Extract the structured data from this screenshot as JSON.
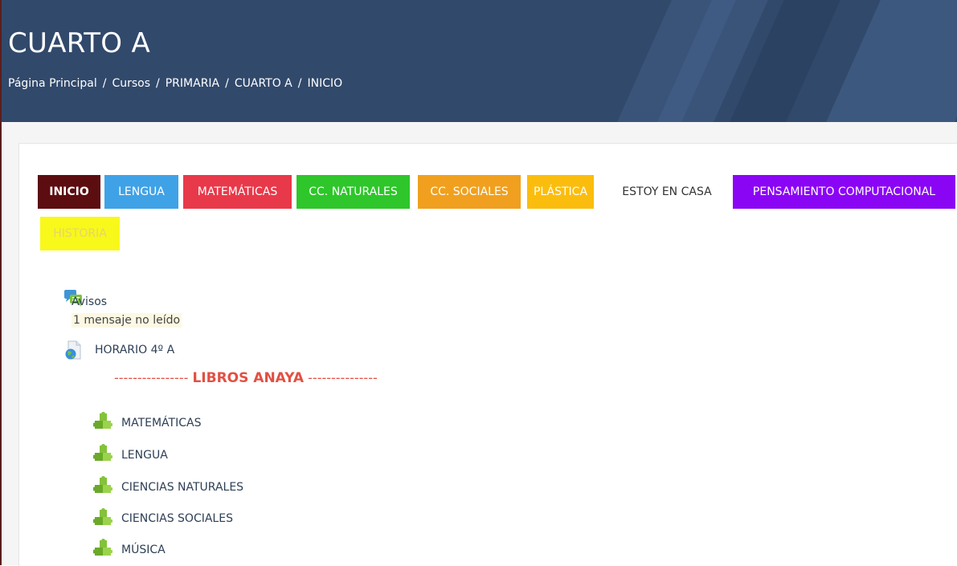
{
  "header": {
    "title": "CUARTO A",
    "breadcrumb": [
      "Página Principal",
      "Cursos",
      "PRIMARIA",
      "CUARTO A",
      "INICIO"
    ],
    "separator": "/"
  },
  "tabs": {
    "inicio": "INICIO",
    "lengua": "LENGUA",
    "matematicas": "MATEMÁTICAS",
    "naturales": "CC. NATURALES",
    "sociales": "CC. SOCIALES",
    "plastica": "PLÁSTICA",
    "estoy_en_casa": "ESTOY EN CASA",
    "pensamiento": "PENSAMIENTO COMPUTACIONAL",
    "historia": "HISTORIA"
  },
  "activities": {
    "avisos": "Avisos",
    "avisos_unread": "1 mensaje no leído",
    "horario": "HORARIO 4º A",
    "libros_prefix": "----------------",
    "libros_label": "LIBROS ANAYA",
    "libros_suffix": "---------------",
    "books": [
      "MATEMÁTICAS",
      "LENGUA",
      "CIENCIAS NATURALES",
      "CIENCIAS SOCIALES",
      "MÚSICA"
    ]
  },
  "icons": {
    "forum": "forum-icon",
    "url": "url-icon",
    "scorm": "puzzle-icon"
  },
  "colors": {
    "header_bg": "#31496b",
    "inicio": "#5c0d10",
    "lengua": "#3fa2e6",
    "matematicas": "#e8394a",
    "naturales": "#2ec62a",
    "sociales": "#f0a01e",
    "plastica": "#fbbd0d",
    "pensamiento": "#8b05f5",
    "historia": "#f8f81a",
    "section_label": "#e25043"
  }
}
